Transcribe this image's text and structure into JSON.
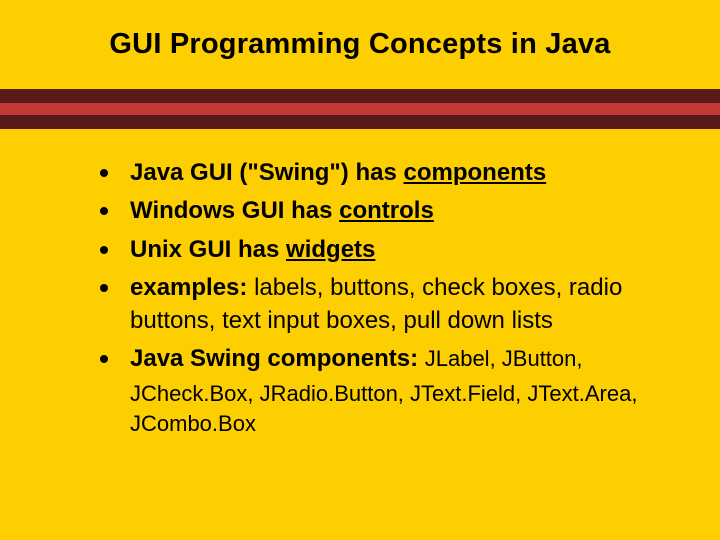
{
  "title": "GUI Programming Concepts in Java",
  "bullets": {
    "b1": {
      "pre": "Java GUI (\"Swing\") has ",
      "u": "components"
    },
    "b2": {
      "pre": "Windows GUI has ",
      "u": "controls"
    },
    "b3": {
      "pre": "Unix GUI has ",
      "u": "widgets"
    },
    "b4": {
      "bold": "examples: ",
      "rest": "labels, buttons, check boxes, radio buttons, text input boxes, pull down lists"
    },
    "b5": {
      "bold": "Java Swing components: ",
      "rest1": "JLabel, JButton,",
      "rest2": "JCheck.Box, JRadio.Button, JText.Field, JText.Area, JCombo.Box"
    }
  }
}
